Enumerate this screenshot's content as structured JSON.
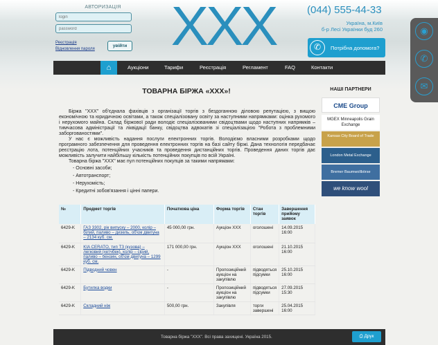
{
  "auth": {
    "title": "АВТОРИЗАЦІЯ",
    "login_placeholder": "login",
    "password_placeholder": "password",
    "register_link": "Реєстрація",
    "restore_link": "Відновлення пароля",
    "submit_label": "увійти"
  },
  "header": {
    "logo": "XXX",
    "phone": "(044) 555-44-33",
    "address_line1": "Україна, м.Київ",
    "address_line2": "б-р Лесі Українки буд 260",
    "help_label": "Потрібна допомога?"
  },
  "nav": {
    "items": [
      "Аукціони",
      "Тарифи",
      "Реєстрація",
      "Регламент",
      "FAQ",
      "Контакти"
    ]
  },
  "content": {
    "title": "ТОВАРНА БІРЖА «XXX»!",
    "p1": "Біржа \"XXX\" об'єднала фахівців з організації торгів з бездоганною діловою репутацією, з вищою економічною та юридичною освітами, а також спеціалізовану освіту за наступними напрямками: оцінка рухомого і нерухомого майна. Склад біржової ради володіє спеціалізованими свідоцтвами щодо наступних напрямків – тимчасова адміністрації та ліквідації банку, свідоцтва адвокатів зі спеціалізацією \"Робота з проблемними заборгованостями\".",
    "p2": "У нас є можливість надання послуги електронних торгів. Володіємо власними розробками щодо програмного забезпечення для проведення електронних торгів на базі сайту біржі. Дана технологія передбачає реєстрацію лота, потенційних учасників та проведення дистанційних торгів. Проведення даних торгів дає можливість залучити найбільшу кількість потенційних покупців по всій Україні.",
    "p3": "Товарна біржа \"XXX\" має пул потенційних покупців за такими напрямами:",
    "list": [
      "- Основні засоби;",
      "- Автотранспорт;",
      "- Нерухомість;",
      "- Кредитні зобов'язання і цінні папери."
    ]
  },
  "partners": {
    "title": "НАШІ ПАРТНЕРИ",
    "items": [
      "CME Group",
      "MGEX Minneapolis Grain Exchange",
      "Kansas City Board of Trade",
      "London Metal Exchange",
      "Bremer Baumwollbörse",
      "we know wool"
    ]
  },
  "table": {
    "headers": [
      "№",
      "Предмет торгів",
      "Початкова ціна",
      "Форма торгів",
      "Стан торгів",
      "Завершення прийому заявок"
    ],
    "rows": [
      [
        "6429-K",
        "ГАЗ 3302, рік випуску – 2000, колір – білий, паливо – дизель, об'єм двигуна – 2134 куб. см.",
        "45 000,00 грн.",
        "Аукціон XXX",
        "оголошені",
        "14.09.2015 16:00"
      ],
      [
        "6429-K",
        "KIA CERATO, тип ТЗ (кузова) – легковий (хетчбек), колір – сірий, паливо – бензин, об'єм двигуна – 1299 куб. см.",
        "171 000,00 грн.",
        "Аукціон XXX",
        "оголошені",
        "21.10.2015 16:00"
      ],
      [
        "6429-K",
        "Підводний човен",
        "-",
        "Пропозиційний аукціон на закупівлю",
        "підводяться підсумки",
        "25.10.2015 16:00"
      ],
      [
        "6429-K",
        "Бутилка водки",
        "-",
        "Пропозиційний аукціон на закупівлю",
        "підводяться підсумки",
        "27.09.2015 15:30"
      ],
      [
        "6429-K",
        "Складний ніж",
        "500,00 грн.",
        "Закупівля",
        "торги завершені",
        "25.04.2015 16:00"
      ]
    ]
  },
  "footer": {
    "copyright": "Товарна біржа \"XXX\". Всі права захищені. Україна 2015.",
    "print_label": "Друк"
  },
  "colors": {
    "accent": "#1e9fcf",
    "nav_bg": "#2e2e2e",
    "table_header": "#d9eef6"
  }
}
